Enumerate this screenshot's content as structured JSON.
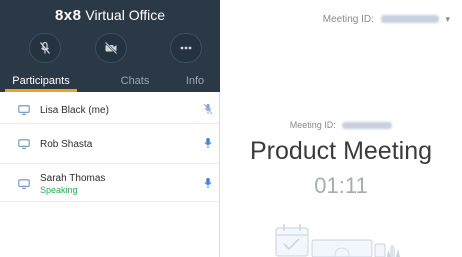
{
  "app": {
    "brand_mark": "8x8",
    "brand_name": "Virtual Office"
  },
  "controls": [
    {
      "name": "mute-mic",
      "icon": "mic-off-icon"
    },
    {
      "name": "video-off",
      "icon": "video-off-icon"
    },
    {
      "name": "more",
      "icon": "more-icon"
    }
  ],
  "tabs": [
    {
      "label": "Participants",
      "active": true
    },
    {
      "label": "Chats",
      "active": false
    },
    {
      "label": "Info",
      "active": false
    }
  ],
  "participants": [
    {
      "name": "Lisa Black (me)",
      "status": "",
      "mic": "muted"
    },
    {
      "name": "Rob Shasta",
      "status": "",
      "mic": "on"
    },
    {
      "name": "Sarah Thomas",
      "status": "Speaking",
      "mic": "on"
    }
  ],
  "meeting": {
    "id_label": "Meeting ID:",
    "title": "Product Meeting",
    "timer": "01:11"
  },
  "colors": {
    "topbar": "#2b3947",
    "accent_tab": "#f0a21a",
    "mic_on": "#3a7ee0",
    "mic_muted": "#8aa6d6",
    "speaking": "#2eaa55"
  }
}
